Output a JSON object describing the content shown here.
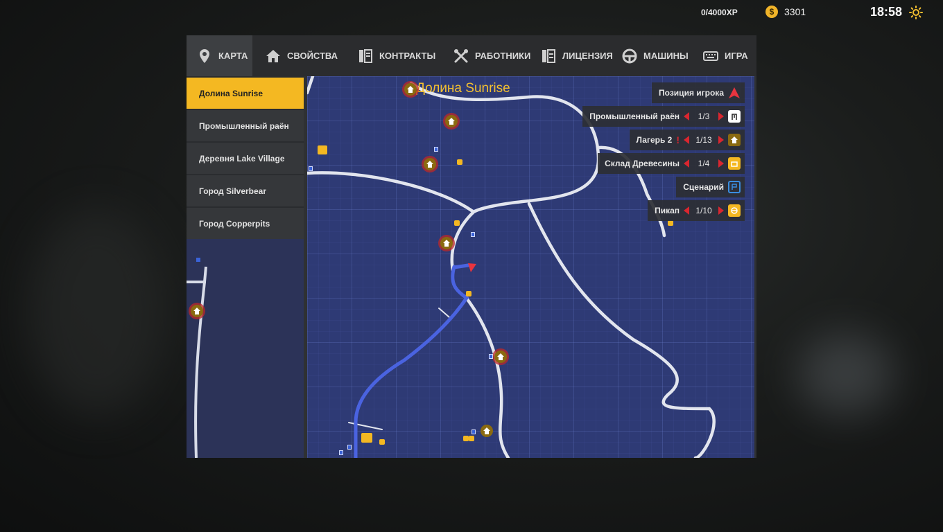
{
  "hud": {
    "xp": "0/4000XP",
    "money": "3301",
    "coin_symbol": "$",
    "time": "18:58",
    "icons": [
      "coin-icon",
      "sun-icon"
    ]
  },
  "tabs": [
    {
      "label": "КАРТА",
      "icon": "map-pin-icon",
      "active": true
    },
    {
      "label": "СВОЙСТВА",
      "icon": "house-icon",
      "active": false
    },
    {
      "label": "КОНТРАКТЫ",
      "icon": "contract-icon",
      "active": false
    },
    {
      "label": "РАБОТНИКИ",
      "icon": "tools-icon",
      "active": false
    },
    {
      "label": "ЛИЦЕНЗИЯ",
      "icon": "license-icon",
      "active": false
    },
    {
      "label": "МАШИНЫ",
      "icon": "steering-wheel-icon",
      "active": false
    },
    {
      "label": "ИГРА",
      "icon": "keyboard-icon",
      "active": false
    }
  ],
  "sidebar": {
    "items": [
      {
        "label": "Долина Sunrise",
        "active": true
      },
      {
        "label": "Промышленный раён",
        "active": false
      },
      {
        "label": "Деревня Lake Village",
        "active": false
      },
      {
        "label": "Город Silverbear",
        "active": false
      },
      {
        "label": "Город Copperpits",
        "active": false
      }
    ]
  },
  "map": {
    "title": "Долина Sunrise",
    "legend": [
      {
        "label": "Позиция игрока",
        "count": "",
        "icon": "player-arrow-icon",
        "has_arrows": false,
        "alert": false
      },
      {
        "label": "Промышленный раён",
        "count": "1/3",
        "icon": "industry-icon",
        "has_arrows": true,
        "alert": false
      },
      {
        "label": "Лагерь 2",
        "count": "1/13",
        "icon": "house-icon",
        "has_arrows": true,
        "alert": true,
        "alert_symbol": "!"
      },
      {
        "label": "Склад Древесины",
        "count": "1/4",
        "icon": "lumber-icon",
        "has_arrows": true,
        "alert": false
      },
      {
        "label": "Сценарий",
        "count": "",
        "icon": "scenario-flag-icon",
        "has_arrows": false,
        "alert": false
      },
      {
        "label": "Пикап",
        "count": "1/10",
        "icon": "pickup-icon",
        "has_arrows": true,
        "alert": false
      }
    ]
  },
  "colors": {
    "accent": "#f4b822",
    "map_bg": "#2e3a75",
    "route": "#4a63e0",
    "alert": "#d9262f"
  }
}
